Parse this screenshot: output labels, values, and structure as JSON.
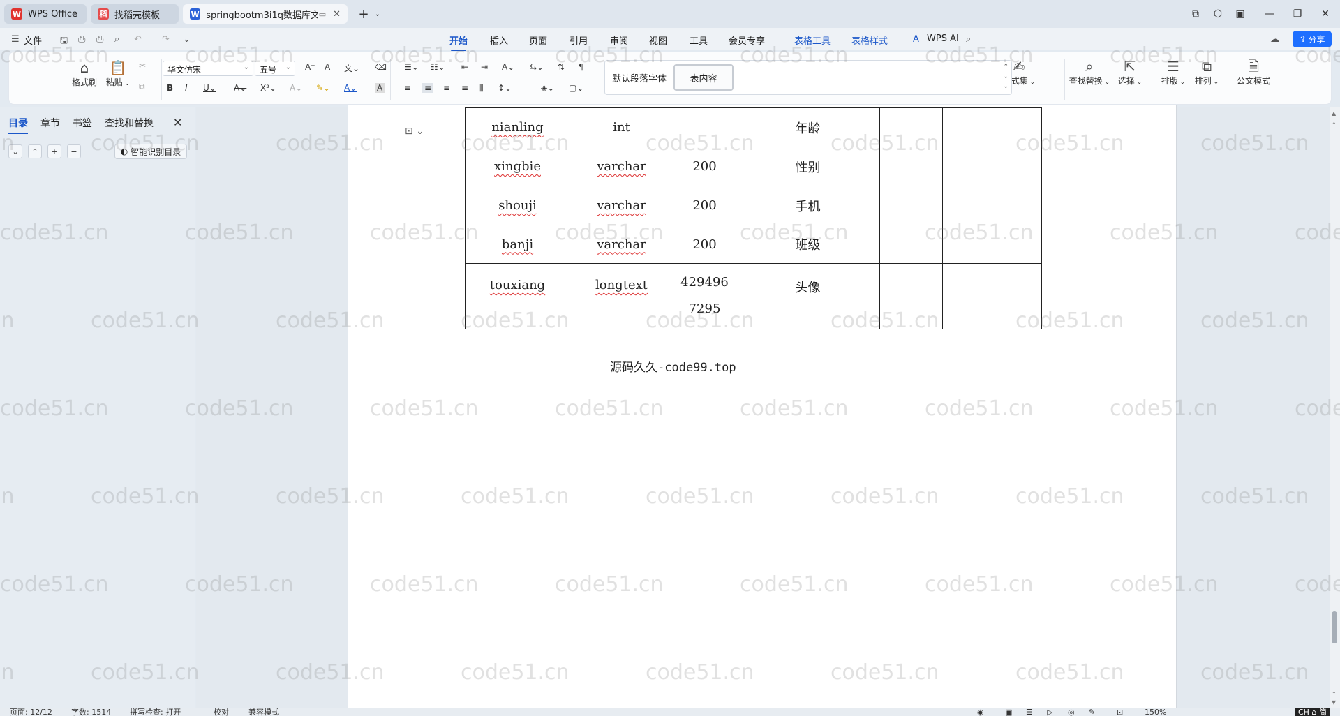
{
  "titlebar": {
    "tabs": [
      {
        "label": "WPS Office",
        "icon": "wps-logo-icon"
      },
      {
        "label": "找稻壳模板",
        "icon": "docer-icon"
      },
      {
        "label": "springbootm3i1q数据库文",
        "icon": "word-doc-icon"
      }
    ],
    "new_tab_symbol": "+"
  },
  "menubar": {
    "file_label": "文件",
    "tabs": [
      "开始",
      "插入",
      "页面",
      "引用",
      "审阅",
      "视图",
      "工具",
      "会员专享",
      "表格工具",
      "表格样式"
    ],
    "active_tab": "开始",
    "wps_ai_label": "WPS AI",
    "share_label": "分享"
  },
  "ribbon": {
    "format_painter": "格式刷",
    "paste": "粘贴",
    "font_name": "华文仿宋",
    "font_size": "五号",
    "style_default": "默认段落字体",
    "style_selected": "表内容",
    "style_set": "样式集",
    "find_replace": "查找替换",
    "select": "选择",
    "layout": "排版",
    "arrange": "排列",
    "official_mode": "公文模式",
    "accent_color": "#1b57c9"
  },
  "navpane": {
    "tabs": [
      "目录",
      "章节",
      "书签",
      "查找和替换"
    ],
    "active_tab": "目录",
    "smart_toc_label": "智能识别目录"
  },
  "document": {
    "rows": [
      {
        "name": "nianling",
        "type": "int",
        "length": "",
        "comment": "年龄"
      },
      {
        "name": "xingbie",
        "type": "varchar",
        "length": "200",
        "comment": "性别"
      },
      {
        "name": "shouji",
        "type": "varchar",
        "length": "200",
        "comment": "手机"
      },
      {
        "name": "banji",
        "type": "varchar",
        "length": "200",
        "comment": "班级"
      },
      {
        "name": "touxiang",
        "type": "longtext",
        "length_line1": "429496",
        "length_line2": "7295",
        "comment": "头像"
      }
    ],
    "caption": "源码久久-code99.top",
    "watermark": "code51.cn"
  },
  "statusbar": {
    "page": "页面: 12/12",
    "words": "字数: 1514",
    "spell": "拼写检查: 打开",
    "proof": "校对",
    "compat": "兼容模式",
    "zoom": "150%",
    "ime": "CH ⌂ 简"
  }
}
